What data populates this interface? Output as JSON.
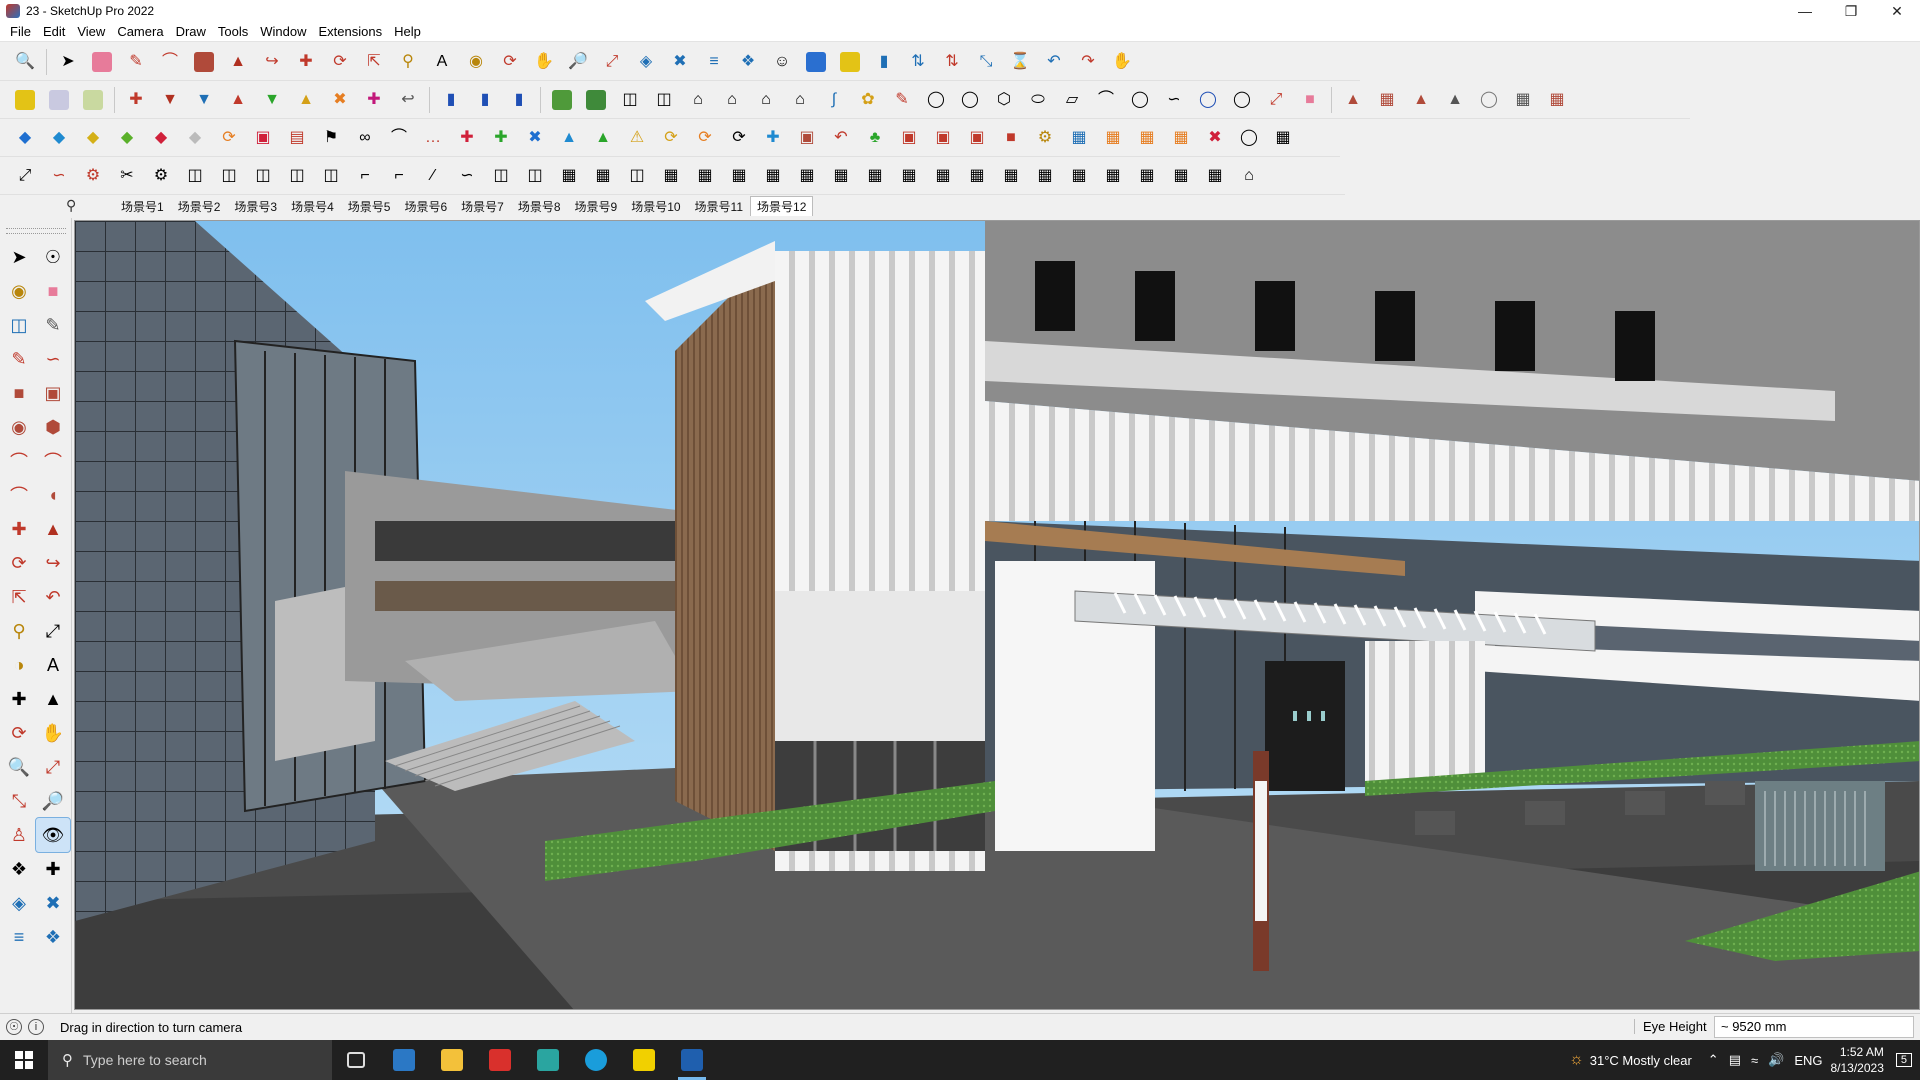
{
  "window": {
    "title": "23 - SketchUp Pro 2022",
    "controls": [
      "minimize-icon",
      "maximize-icon",
      "close-icon"
    ]
  },
  "menu": [
    "File",
    "Edit",
    "View",
    "Camera",
    "Draw",
    "Tools",
    "Window",
    "Extensions",
    "Help"
  ],
  "scenes": {
    "tabs": [
      "场景号1",
      "场景号2",
      "场景号3",
      "场景号4",
      "场景号5",
      "场景号6",
      "场景号7",
      "场景号8",
      "场景号9",
      "场景号10",
      "场景号11",
      "场景号12"
    ],
    "active": "场景号12"
  },
  "status": {
    "message": "Drag in direction to turn camera",
    "vcb_label": "Eye Height",
    "vcb_value": "~ 9520 mm"
  },
  "taskbar": {
    "search_placeholder": "Type here to search",
    "weather": "31°C  Mostly clear",
    "language": "ENG",
    "time": "1:52 AM",
    "date": "8/13/2023",
    "notification_count": "5"
  },
  "colors": {
    "sky": "#8fc7ee",
    "accent": "#0078d4",
    "taskbar": "#202020"
  }
}
